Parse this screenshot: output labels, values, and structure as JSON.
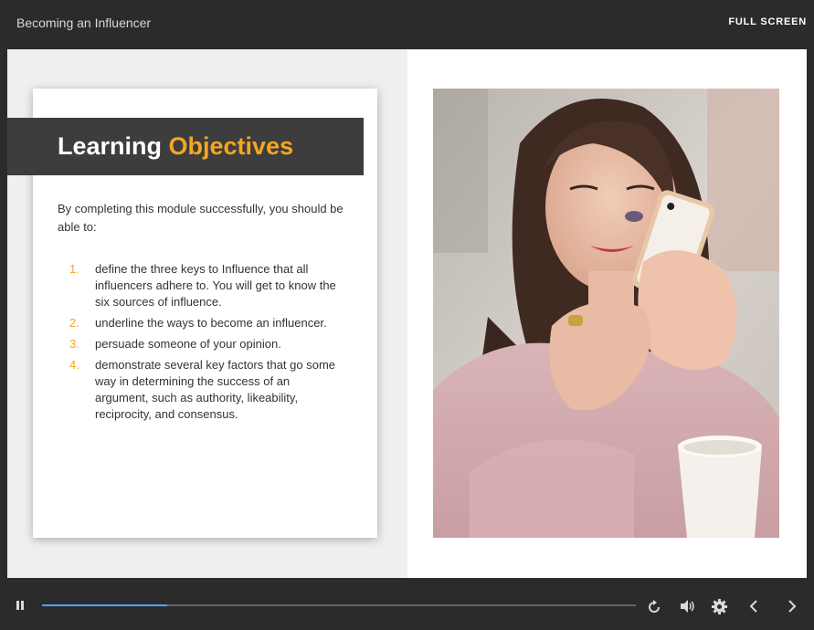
{
  "header": {
    "course_title": "Becoming an Influencer",
    "fullscreen_label": "FULL SCREEN"
  },
  "slide": {
    "title_main": "Learning",
    "title_accent": "Objectives",
    "intro": "By completing this module successfully, you should be able to:",
    "objectives": [
      {
        "num": "1.",
        "text": "define the three keys to Influence that all influencers adhere to. You will get to know the six sources of influence."
      },
      {
        "num": "2.",
        "text": "underline the ways to become an influencer."
      },
      {
        "num": "3.",
        "text": "persuade someone of your opinion."
      },
      {
        "num": "4.",
        "text": "demonstrate several key factors that go some way in determining the success of an argument, such as authority, likeability, reciprocity, and consensus."
      }
    ]
  },
  "player": {
    "progress": 0.21,
    "accent_color": "#4aa8ff",
    "icons": [
      "pause-icon",
      "replay-icon",
      "volume-icon",
      "settings-gear-icon",
      "chevron-left-icon",
      "chevron-right-icon"
    ]
  },
  "colors": {
    "accent": "#f6a623",
    "banner": "#3d3d3d",
    "chrome": "#2b2b2b"
  }
}
